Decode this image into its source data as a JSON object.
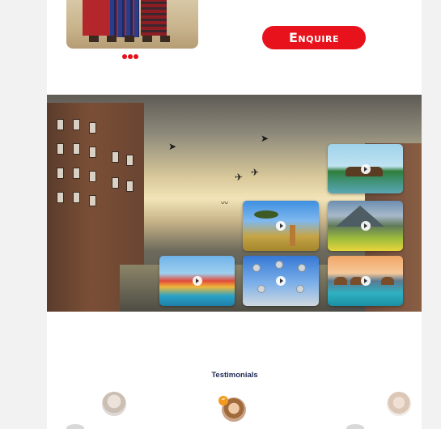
{
  "top_gallery": {
    "image_icon": "maasai-photo",
    "carousel_dots": 3,
    "dot_color": "#e5101b"
  },
  "cta": {
    "enquire_label": "Enquire",
    "color": "#e8121c"
  },
  "hero": {
    "background_icon": "amsterdam-canal-photo",
    "video_thumbnails": [
      {
        "name": "houseboat-video",
        "icon": "play-icon"
      },
      {
        "name": "giraffe-safari-video",
        "icon": "play-icon"
      },
      {
        "name": "alpine-valley-video",
        "icon": "play-icon"
      },
      {
        "name": "waterpark-video",
        "icon": "play-icon"
      },
      {
        "name": "atomium-video",
        "icon": "play-icon"
      },
      {
        "name": "overwater-resort-video",
        "icon": "play-icon"
      }
    ]
  },
  "testimonials": {
    "title": "Testimonials",
    "quote_mark": "“",
    "accent_color": "#f39a1e",
    "title_color": "#1f2a56"
  }
}
